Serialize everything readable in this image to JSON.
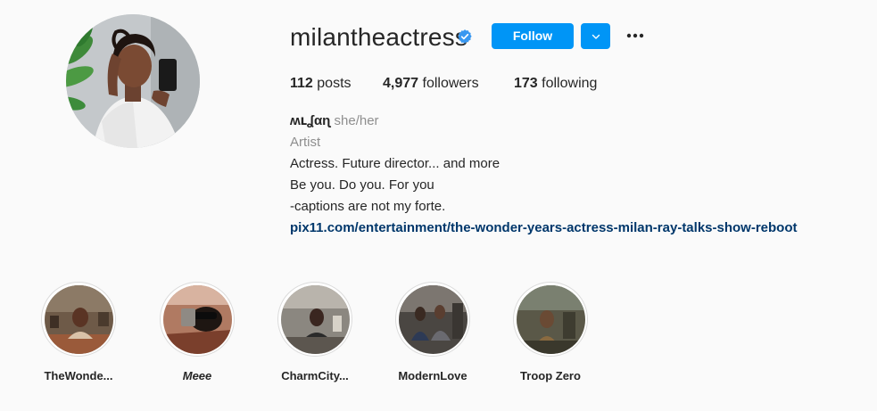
{
  "profile": {
    "username": "milantheactress",
    "verified": true,
    "follow_label": "Follow",
    "avatar_icon": "profile-photo"
  },
  "stats": {
    "posts_count": "112",
    "posts_label": "posts",
    "followers_count": "4,977",
    "followers_label": "followers",
    "following_count": "173",
    "following_label": "following"
  },
  "bio": {
    "display_name": "ʍւʆαɳ",
    "pronouns": "she/her",
    "category": "Artist",
    "lines": [
      "Actress. Future director... and more",
      "Be you. Do you. For you",
      "-captions are not my forte."
    ],
    "link": "pix11.com/entertainment/the-wonder-years-actress-milan-ray-talks-show-reboot"
  },
  "highlights": [
    {
      "label": "TheWonde...",
      "italic": false
    },
    {
      "label": "Meee",
      "italic": true
    },
    {
      "label": "CharmCity...",
      "italic": false
    },
    {
      "label": "ModernLove",
      "italic": false
    },
    {
      "label": "Troop Zero",
      "italic": false
    }
  ],
  "colors": {
    "accent": "#0095f6",
    "verified": "#3897f0",
    "link": "#00376b",
    "muted": "#8e8e8e",
    "background": "#fafafa"
  }
}
